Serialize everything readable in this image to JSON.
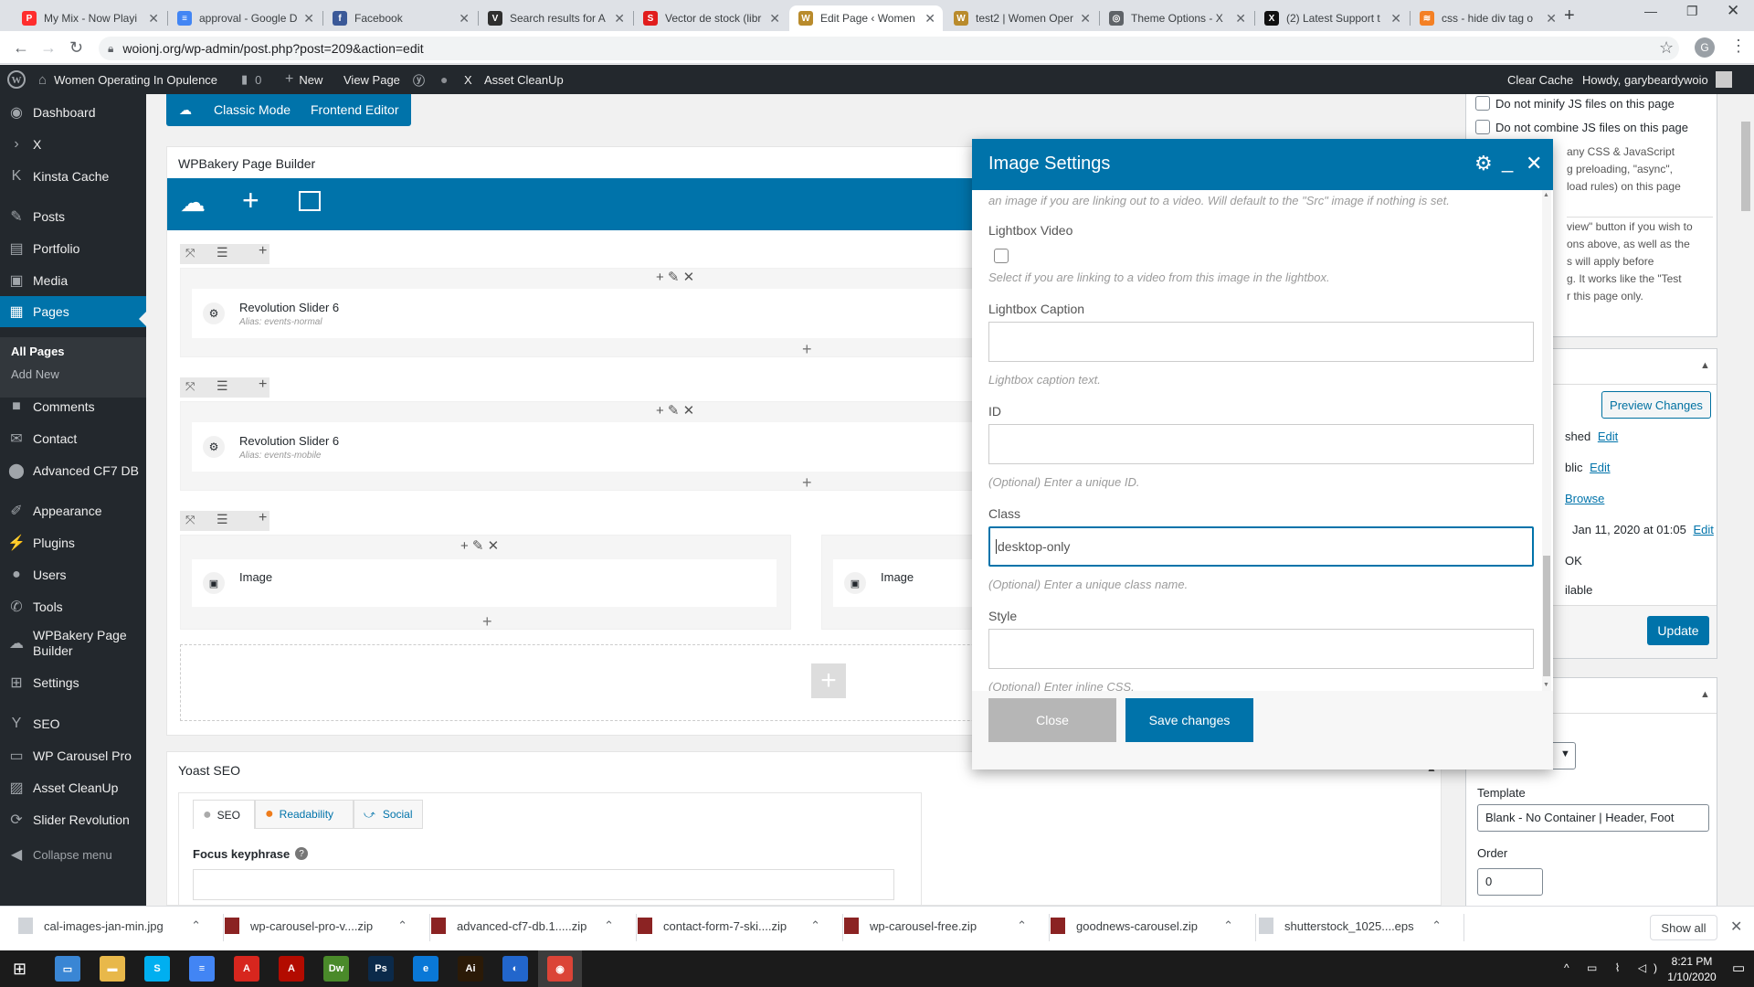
{
  "browser": {
    "tabs": [
      {
        "title": "My Mix - Now Playi",
        "color": "#ff2d2d",
        "glyph": "P"
      },
      {
        "title": "approval - Google D",
        "color": "#4285f4",
        "glyph": "≡"
      },
      {
        "title": "Facebook",
        "color": "#3b5998",
        "glyph": "f"
      },
      {
        "title": "Search results for A",
        "color": "#2f2f2f",
        "glyph": "V"
      },
      {
        "title": "Vector de stock (libr",
        "color": "#e11d1d",
        "glyph": "S"
      },
      {
        "title": "Edit Page ‹ Women",
        "color": "#b98b2c",
        "glyph": "W"
      },
      {
        "title": "test2 | Women Oper",
        "color": "#b98b2c",
        "glyph": "W"
      },
      {
        "title": "Theme Options - X",
        "color": "#5f6368",
        "glyph": "◎"
      },
      {
        "title": "(2) Latest Support t",
        "color": "#111111",
        "glyph": "X"
      },
      {
        "title": "css - hide div tag o",
        "color": "#f48024",
        "glyph": "≋"
      }
    ],
    "active_tab": 5,
    "url": "woionj.org/wp-admin/post.php?post=209&action=edit",
    "profile_initial": "G"
  },
  "adminbar": {
    "site_name": "Women Operating In Opulence",
    "comments": "0",
    "new": "New",
    "view_page": "View Page",
    "x": "X",
    "asset_cleanup": "Asset CleanUp",
    "clear_cache": "Clear Cache",
    "howdy": "Howdy, garybeardywoio"
  },
  "sidebar": {
    "items": [
      {
        "label": "Dashboard",
        "icon": "dashboard-icon",
        "glyph": "◉"
      },
      {
        "label": "X",
        "icon": "x-icon",
        "glyph": "›"
      },
      {
        "label": "Kinsta Cache",
        "icon": "kinsta-icon",
        "glyph": "K"
      },
      {
        "label": "Posts",
        "icon": "pin-icon",
        "glyph": "✎"
      },
      {
        "label": "Portfolio",
        "icon": "portfolio-icon",
        "glyph": "▤"
      },
      {
        "label": "Media",
        "icon": "media-icon",
        "glyph": "▣"
      },
      {
        "label": "Pages",
        "icon": "pages-icon",
        "glyph": "▦"
      },
      {
        "label": "Comments",
        "icon": "comment-icon",
        "glyph": "■"
      },
      {
        "label": "Contact",
        "icon": "mail-icon",
        "glyph": "✉"
      },
      {
        "label": "Advanced CF7 DB",
        "icon": "database-icon",
        "glyph": "⬤"
      },
      {
        "label": "Appearance",
        "icon": "brush-icon",
        "glyph": "✐"
      },
      {
        "label": "Plugins",
        "icon": "plugin-icon",
        "glyph": "⚡"
      },
      {
        "label": "Users",
        "icon": "user-icon",
        "glyph": "●"
      },
      {
        "label": "Tools",
        "icon": "wrench-icon",
        "glyph": "✆"
      },
      {
        "label": "WPBakery Page Builder",
        "icon": "wpbakery-icon",
        "glyph": "☁"
      },
      {
        "label": "Settings",
        "icon": "settings-icon",
        "glyph": "⊞"
      },
      {
        "label": "SEO",
        "icon": "yoast-icon",
        "glyph": "Y"
      },
      {
        "label": "WP Carousel Pro",
        "icon": "carousel-icon",
        "glyph": "▭"
      },
      {
        "label": "Asset CleanUp",
        "icon": "cleanup-icon",
        "glyph": "▨"
      },
      {
        "label": "Slider Revolution",
        "icon": "slider-icon",
        "glyph": "⟳"
      },
      {
        "label": "Collapse menu",
        "icon": "collapse-icon",
        "glyph": "◀"
      }
    ],
    "submenu": [
      "All Pages",
      "Add New"
    ]
  },
  "builder": {
    "classic_mode": "Classic Mode",
    "frontend_editor": "Frontend Editor",
    "title": "WPBakery Page Builder",
    "elements": [
      {
        "name": "Revolution Slider 6",
        "alias": "Alias: events-normal"
      },
      {
        "name": "Revolution Slider 6",
        "alias": "Alias: events-mobile"
      },
      {
        "name": "Image"
      },
      {
        "name": "Image"
      }
    ]
  },
  "yoast": {
    "title": "Yoast SEO",
    "tabs": [
      "SEO",
      "Readability",
      "Social"
    ],
    "focus_keyphrase": "Focus keyphrase"
  },
  "modal": {
    "title": "Image Settings",
    "top_help": "an image if you are linking out to a video. Will default to the \"Src\" image if nothing is set.",
    "lightbox_video_label": "Lightbox Video",
    "lightbox_video_help": "Select if you are linking to a video from this image in the lightbox.",
    "lightbox_caption_label": "Lightbox Caption",
    "lightbox_caption_value": "",
    "lightbox_caption_help": "Lightbox caption text.",
    "id_label": "ID",
    "id_value": "",
    "id_help": "(Optional) Enter a unique ID.",
    "class_label": "Class",
    "class_value": "desktop-only",
    "class_help": "(Optional) Enter a unique class name.",
    "style_label": "Style",
    "style_value": "",
    "style_help": "(Optional) Enter inline CSS.",
    "close_button": "Close",
    "save_button": "Save changes"
  },
  "right_panel": {
    "no_minify": "Do not minify JS files on this page",
    "no_combine": "Do not combine JS files on this page",
    "text_lines_a": [
      "any CSS & JavaScript",
      "g preloading, \"async\",",
      "load rules) on this page"
    ],
    "text_lines_b": [
      "view\" button if you wish to",
      "ons above, as well as the",
      "s will apply before",
      "g. It works like the \"Test",
      "r this page only."
    ],
    "preview_changes": "Preview Changes",
    "status_frag": "shed",
    "visibility_frag": "blic",
    "revisions_frag": "Browse",
    "published_frag": "Jan 11, 2020 at 01:05",
    "edit": "Edit",
    "ok_frag": "OK",
    "available_frag": "ilable",
    "update": "Update",
    "template_label": "Template",
    "template_value": "Blank - No Container | Header, Foot",
    "order_label": "Order",
    "order_value": "0"
  },
  "downloads": {
    "items": [
      "cal-images-jan-min.jpg",
      "wp-carousel-pro-v....zip",
      "advanced-cf7-db.1.....zip",
      "contact-form-7-ski....zip",
      "wp-carousel-free.zip",
      "goodnews-carousel.zip",
      "shutterstock_1025....eps"
    ],
    "show_all": "Show all"
  },
  "taskbar": {
    "time": "8:21 PM",
    "date": "1/10/2020",
    "apps": [
      {
        "name": "file-explorer-icon",
        "glyph": "▭",
        "color": "#3a86d4"
      },
      {
        "name": "folder-icon",
        "glyph": "▬",
        "color": "#e8b84a"
      },
      {
        "name": "skype-icon",
        "glyph": "S",
        "color": "#00aff0"
      },
      {
        "name": "docs-icon",
        "glyph": "≡",
        "color": "#4285f4"
      },
      {
        "name": "acrobat-icon",
        "glyph": "A",
        "color": "#d7261e"
      },
      {
        "name": "pdf-icon",
        "glyph": "A",
        "color": "#b30b00"
      },
      {
        "name": "dreamweaver-icon",
        "glyph": "Dw",
        "color": "#4a8a2a"
      },
      {
        "name": "photoshop-icon",
        "glyph": "Ps",
        "color": "#0b2a4a"
      },
      {
        "name": "edge-icon",
        "glyph": "e",
        "color": "#0a78d7"
      },
      {
        "name": "illustrator-icon",
        "glyph": "Ai",
        "color": "#2b1a07"
      },
      {
        "name": "chat-icon",
        "glyph": "◐",
        "color": "#2266cc"
      },
      {
        "name": "chrome-icon",
        "glyph": "◉",
        "color": "#db4437"
      }
    ]
  },
  "colors": {
    "wp_blue": "#0073aa",
    "admin_dark": "#23282d",
    "modal_header": "#0073aa"
  }
}
